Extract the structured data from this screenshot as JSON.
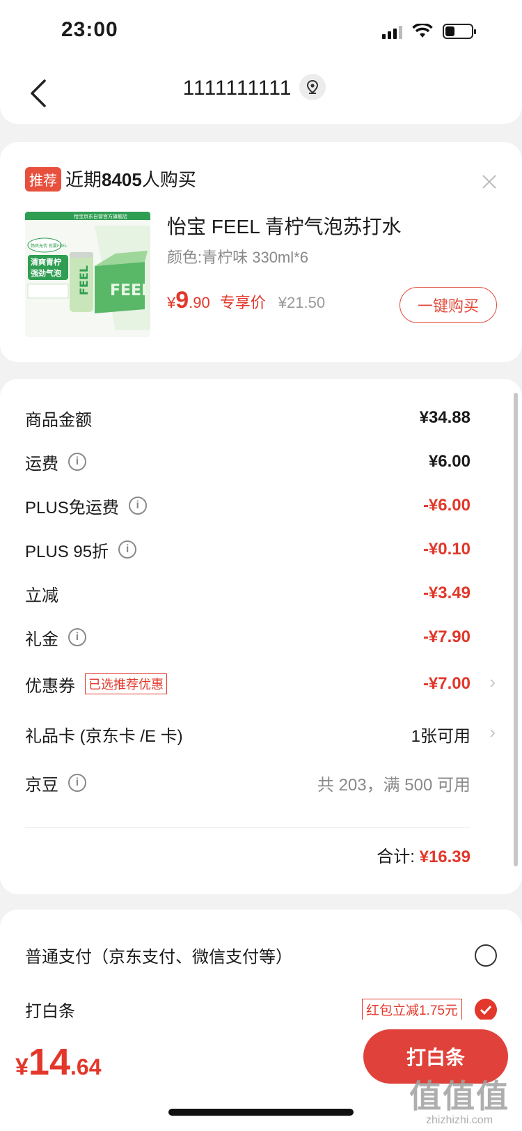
{
  "status_bar": {
    "time": "23:00",
    "battery_level": 0.35
  },
  "header": {
    "title": "1111111111"
  },
  "recommend": {
    "badge": "推荐",
    "text_prefix": "近期",
    "count": "8405",
    "text_suffix": "人购买",
    "product": {
      "title": "怡宝 FEEL 青柠气泡苏打水",
      "spec": "颜色:青柠味 330ml*6",
      "price_yen": "¥",
      "price_int": "9",
      "price_dec": ".90",
      "price_label": "专享价",
      "orig_price": "¥21.50",
      "buy_label": "一键购买",
      "image_texts": {
        "banner": "怡宝京东自营官方旗舰店",
        "slogan1": "清爽青柠",
        "slogan2": "强劲气泡",
        "bubble": "畅爽无忧 就要FEEL",
        "can_brand": "FEEL"
      }
    }
  },
  "amounts": {
    "rows": [
      {
        "label": "商品金额",
        "value": "¥34.88"
      },
      {
        "label": "运费",
        "value": "¥6.00"
      },
      {
        "label": "PLUS免运费",
        "value": "-¥6.00"
      },
      {
        "label": "PLUS 95折",
        "value": "-¥0.10"
      },
      {
        "label": "立减",
        "value": "-¥3.49"
      },
      {
        "label": "礼金",
        "value": "-¥7.90"
      },
      {
        "label": "优惠券",
        "tag": "已选推荐优惠",
        "value": "-¥7.00"
      },
      {
        "label": "礼品卡 (京东卡 /E 卡)",
        "value": "1张可用"
      },
      {
        "label": "京豆",
        "value": "共 203，满 500 可用"
      }
    ],
    "total_label": "合计:",
    "total_value": "¥16.39"
  },
  "payment": {
    "normal_label": "普通支付（京东支付、微信支付等）",
    "baitiao_label": "打白条",
    "baitiao_tag": "红包立减1.75元"
  },
  "bottom": {
    "price_yen": "¥",
    "price_int": "14",
    "price_dec": ".64",
    "pay_label": "打白条"
  },
  "watermark": {
    "big": "值值值",
    "small": "zhizhizhi.com"
  },
  "colors": {
    "accent": "#e2372a",
    "button": "#e0423b"
  }
}
